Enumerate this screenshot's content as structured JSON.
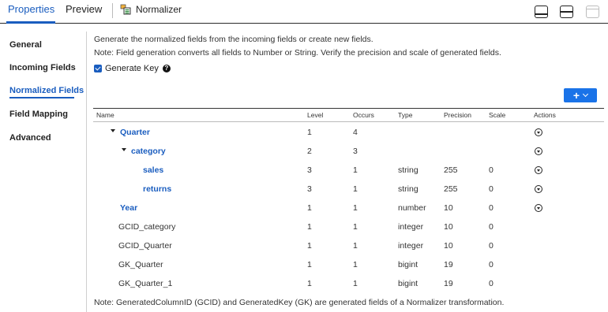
{
  "tabs": [
    {
      "label": "Properties",
      "active": true
    },
    {
      "label": "Preview",
      "active": false
    }
  ],
  "transformation": {
    "name": "Normalizer",
    "icon": "normalizer-icon"
  },
  "layout_buttons": [
    "layout-bottom-panel-icon",
    "layout-split-icon",
    "layout-top-panel-icon"
  ],
  "nav": {
    "items": [
      {
        "label": "General",
        "active": false
      },
      {
        "label": "Incoming Fields",
        "active": false
      },
      {
        "label": "Normalized Fields",
        "active": true
      },
      {
        "label": "Field Mapping",
        "active": false
      },
      {
        "label": "Advanced",
        "active": false
      }
    ]
  },
  "content": {
    "description": "Generate the normalized fields from the incoming fields or create new fields.",
    "note": "Note: Field generation converts all fields to Number or String. Verify the precision and scale of generated fields.",
    "generate_key_label": "Generate Key",
    "generate_key_checked": true,
    "help_glyph": "?",
    "add_button_glyph": "+",
    "footnote": "Note: GeneratedColumnID (GCID) and GeneratedKey (GK) are generated fields of a Normalizer transformation."
  },
  "table": {
    "headers": {
      "name": "Name",
      "level": "Level",
      "occurs": "Occurs",
      "type": "Type",
      "precision": "Precision",
      "scale": "Scale",
      "actions": "Actions"
    },
    "rows": [
      {
        "name": "Quarter",
        "level": "1",
        "occurs": "4",
        "type": "",
        "precision": "",
        "scale": "",
        "indent": 0,
        "expanded": true,
        "link": true,
        "action": true
      },
      {
        "name": "category",
        "level": "2",
        "occurs": "3",
        "type": "",
        "precision": "",
        "scale": "",
        "indent": 1,
        "expanded": true,
        "link": true,
        "action": true
      },
      {
        "name": "sales",
        "level": "3",
        "occurs": "1",
        "type": "string",
        "precision": "255",
        "scale": "0",
        "indent": 2,
        "expanded": false,
        "link": true,
        "action": true
      },
      {
        "name": "returns",
        "level": "3",
        "occurs": "1",
        "type": "string",
        "precision": "255",
        "scale": "0",
        "indent": 2,
        "expanded": false,
        "link": true,
        "action": true
      },
      {
        "name": "Year",
        "level": "1",
        "occurs": "1",
        "type": "number",
        "precision": "10",
        "scale": "0",
        "indent": 0,
        "expanded": false,
        "link": true,
        "action": true
      },
      {
        "name": "GCID_category",
        "level": "1",
        "occurs": "1",
        "type": "integer",
        "precision": "10",
        "scale": "0",
        "indent": -1,
        "expanded": false,
        "link": false,
        "action": false
      },
      {
        "name": "GCID_Quarter",
        "level": "1",
        "occurs": "1",
        "type": "integer",
        "precision": "10",
        "scale": "0",
        "indent": -1,
        "expanded": false,
        "link": false,
        "action": false
      },
      {
        "name": "GK_Quarter",
        "level": "1",
        "occurs": "1",
        "type": "bigint",
        "precision": "19",
        "scale": "0",
        "indent": -1,
        "expanded": false,
        "link": false,
        "action": false
      },
      {
        "name": "GK_Quarter_1",
        "level": "1",
        "occurs": "1",
        "type": "bigint",
        "precision": "19",
        "scale": "0",
        "indent": -1,
        "expanded": false,
        "link": false,
        "action": false
      }
    ]
  }
}
